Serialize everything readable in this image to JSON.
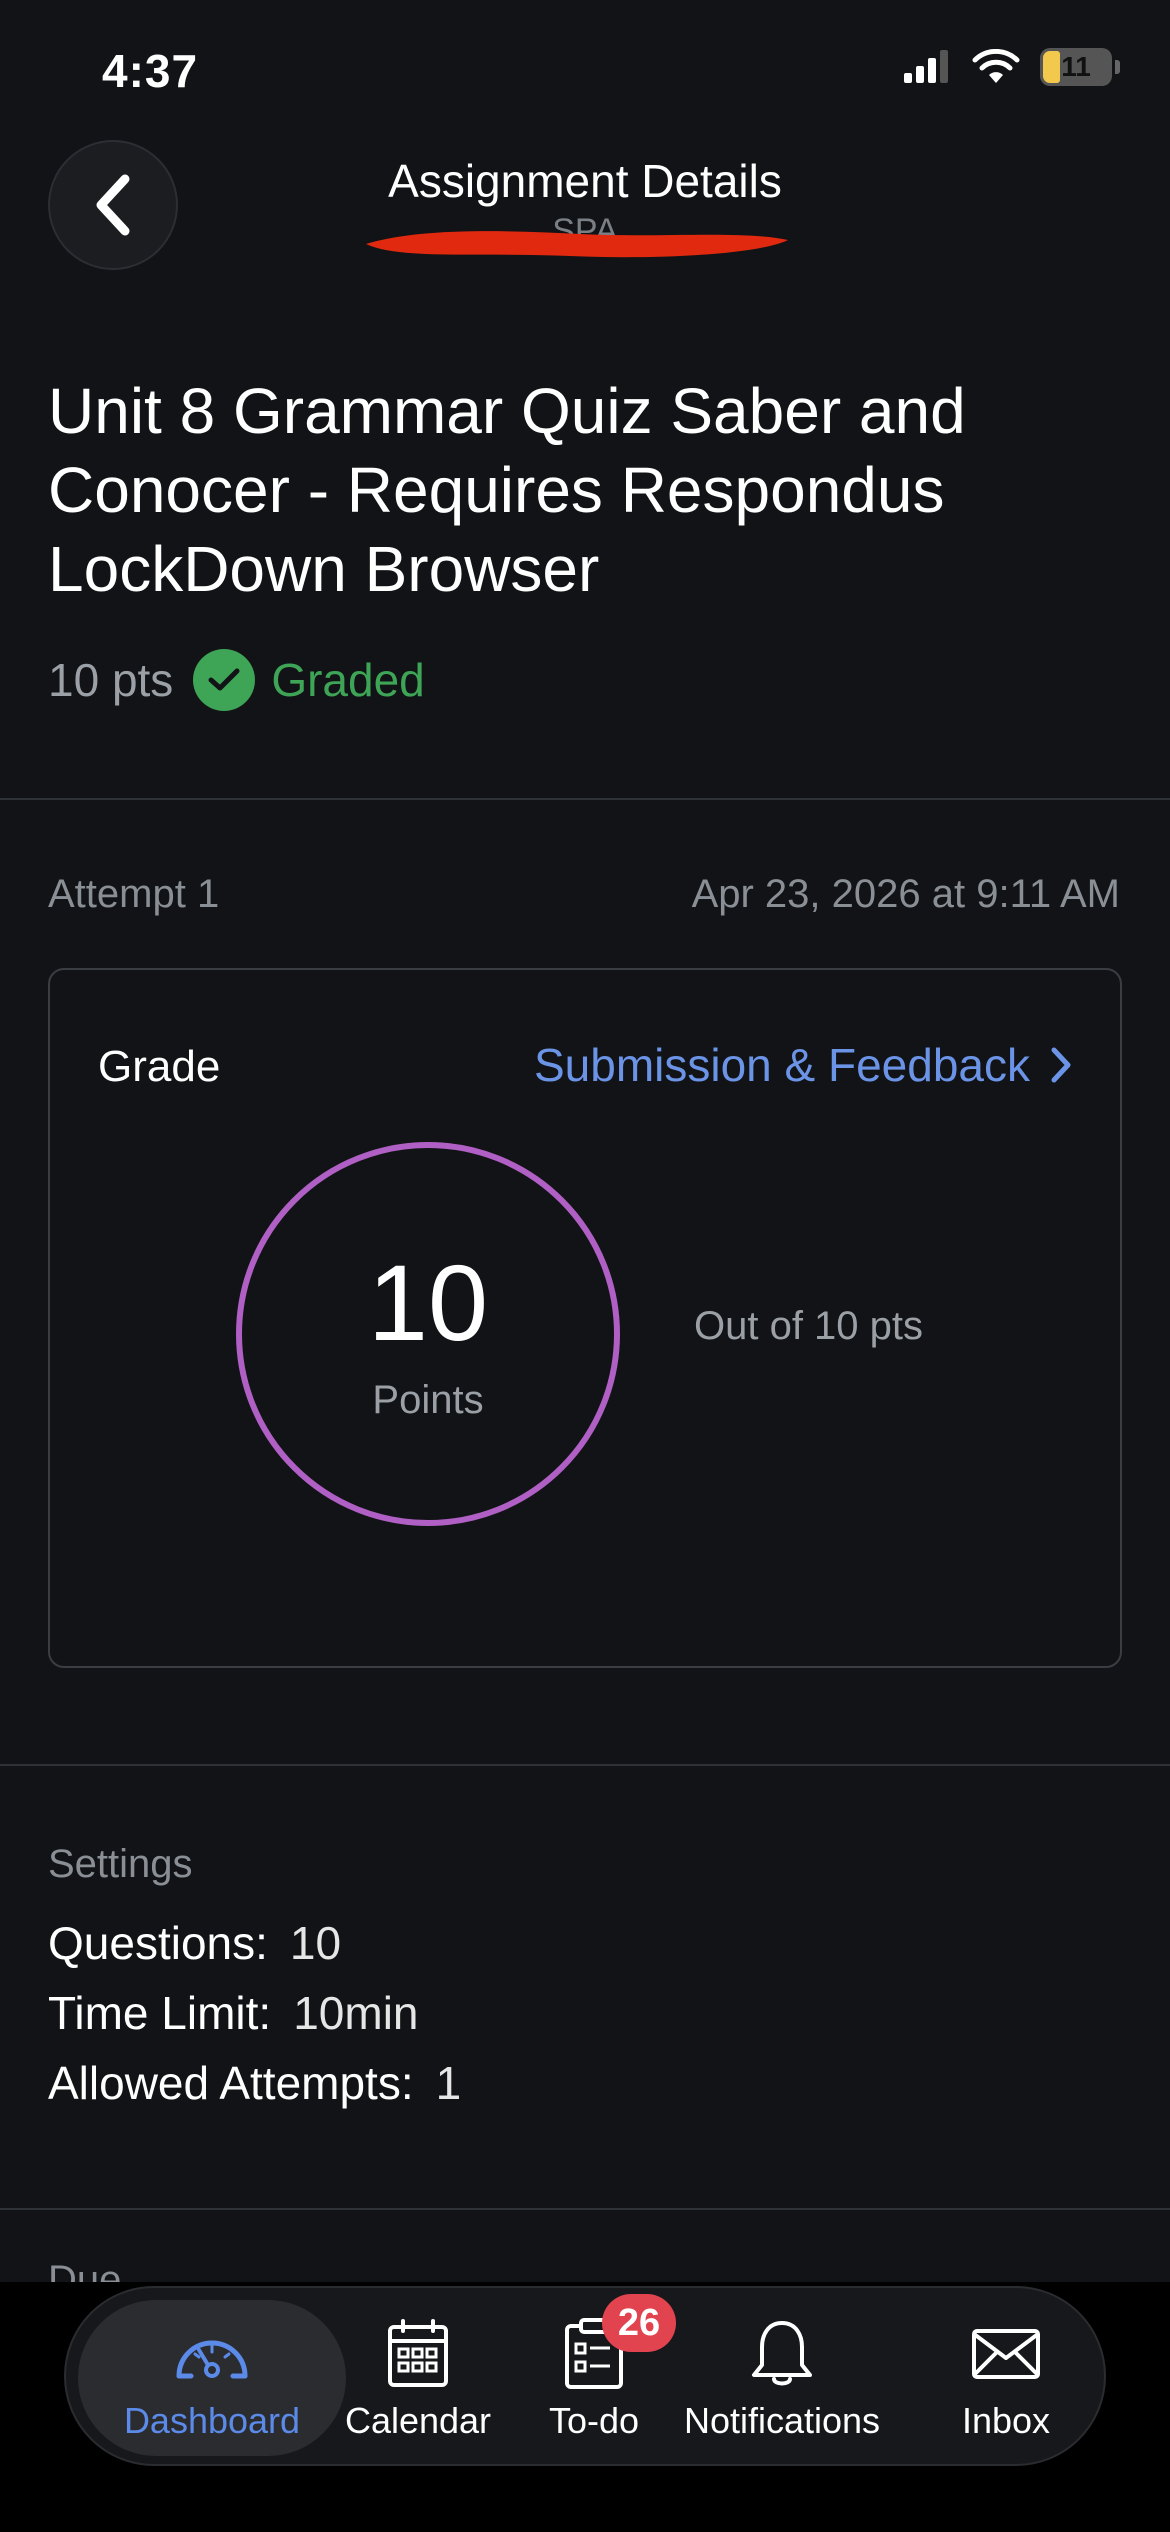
{
  "status_bar": {
    "time": "4:37",
    "battery": "11"
  },
  "header": {
    "title": "Assignment Details",
    "subtitle": "SPA"
  },
  "assignment": {
    "title": "Unit 8 Grammar Quiz Saber and Conocer - Requires Respondus LockDown Browser",
    "points": "10 pts",
    "status": "Graded"
  },
  "attempt": {
    "label": "Attempt 1",
    "date": "Apr 23, 2026 at 9:11 AM"
  },
  "grade_card": {
    "label": "Grade",
    "feedback_link": "Submission & Feedback",
    "score": "10",
    "score_unit": "Points",
    "out_of": "Out of 10 pts"
  },
  "settings": {
    "label": "Settings",
    "rows": [
      {
        "key": "Questions:",
        "value": "10"
      },
      {
        "key": "Time Limit:",
        "value": "10min"
      },
      {
        "key": "Allowed Attempts:",
        "value": "1"
      }
    ]
  },
  "due": {
    "label": "Due"
  },
  "tab_bar": {
    "items": [
      {
        "label": "Dashboard",
        "icon": "dashboard-gauge-icon",
        "active": true
      },
      {
        "label": "Calendar",
        "icon": "calendar-icon"
      },
      {
        "label": "To-do",
        "icon": "clipboard-checklist-icon",
        "badge": "26"
      },
      {
        "label": "Notifications",
        "icon": "bell-icon"
      },
      {
        "label": "Inbox",
        "icon": "envelope-icon"
      }
    ]
  },
  "colors": {
    "background": "#111316",
    "accent_blue": "#6b93e6",
    "graded_green": "#3ea556",
    "ring_purple": "#b05fc4",
    "badge_red": "#e2444f"
  }
}
